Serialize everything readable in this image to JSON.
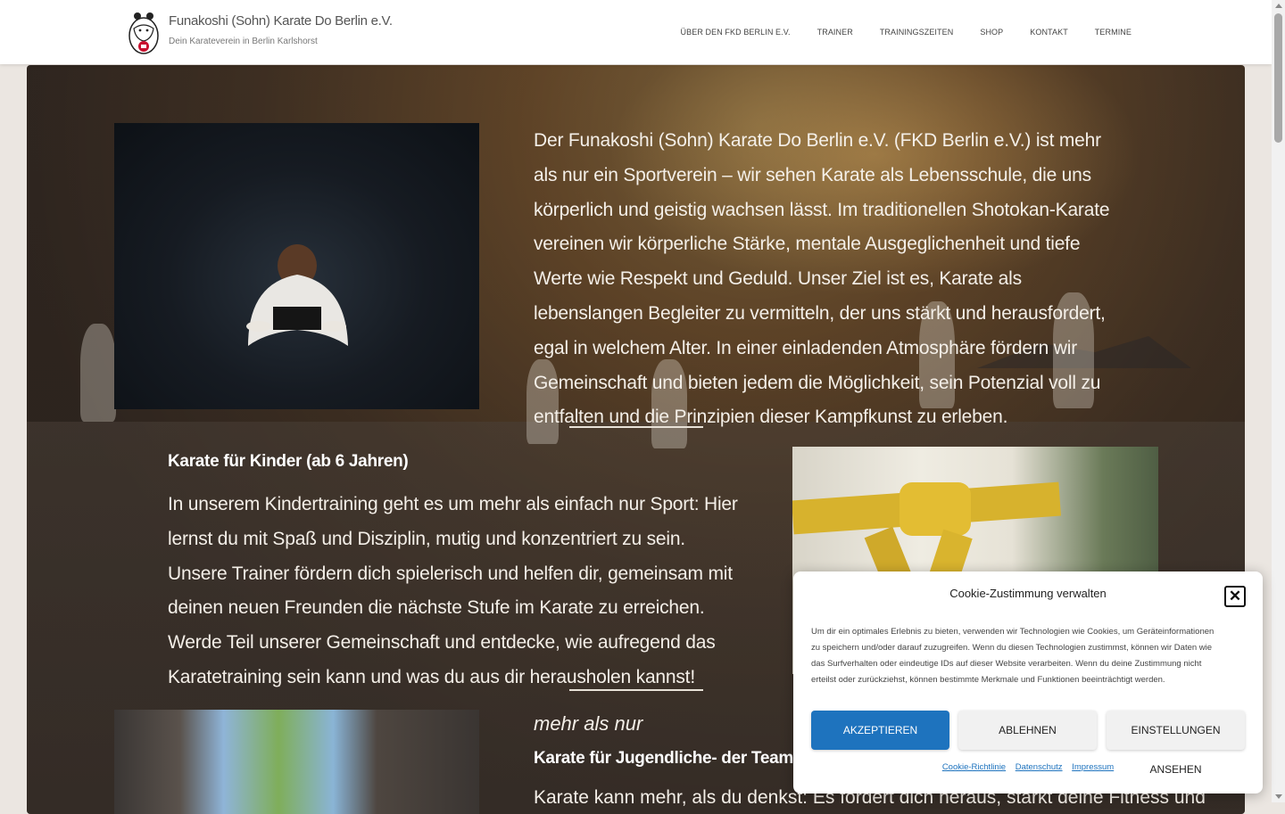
{
  "header": {
    "site_title": "Funakoshi (Sohn) Karate Do Berlin e.V.",
    "tagline": "Dein Karateverein in Berlin Karlshorst",
    "nav": [
      "Über den FKD Berlin e.V.",
      "Trainer",
      "Trainingszeiten",
      "Shop",
      "Kontakt",
      "Termine"
    ]
  },
  "intro": {
    "text": "Der Funakoshi (Sohn) Karate Do Berlin e.V. (FKD Berlin e.V.) ist mehr als nur ein Sportverein – wir sehen Karate als Lebensschule, die uns körperlich und geistig wachsen lässt. Im traditionellen Shotokan-Karate vereinen wir körperliche Stärke, mentale Ausgeglichenheit und tiefe Werte wie Respekt und Geduld. Unser Ziel ist es, Karate als lebenslangen Begleiter zu vermitteln, der uns stärkt und herausfordert, egal in welchem Alter. In einer einladenden Atmosphäre fördern wir Gemeinschaft und bieten jedem die Möglichkeit, sein Potenzial voll zu entfalten und die Prinzipien dieser Kampfkunst zu erleben."
  },
  "kids": {
    "title": "Karate für Kinder (ab 6 Jahren)",
    "text": "In unserem Kindertraining geht es um mehr als einfach nur Sport: Hier lernst du mit Spaß und Disziplin, mutig und konzentriert zu sein. Unsere Trainer fördern dich spielerisch und helfen dir, gemeinsam mit deinen neuen Freunden die nächste Stufe im Karate zu erreichen. Werde Teil unserer Gemeinschaft und entdecke, wie aufregend das Karatetraining sein kann und was du aus dir herausholen kannst!"
  },
  "youth": {
    "kicker": "mehr als nur",
    "title": "Karate für Jugendliche- der Teamgeist zählt",
    "text": "Karate kann mehr, als du denkst: Es fordert dich heraus, stärkt deine Fitness und"
  },
  "cookie": {
    "title": "Cookie-Zustimmung verwalten",
    "body": "Um dir ein optimales Erlebnis zu bieten, verwenden wir Technologien wie Cookies, um Geräteinformationen zu speichern und/oder darauf zuzugreifen. Wenn du diesen Technologien zustimmst, können wir Daten wie das Surfverhalten oder eindeutige IDs auf dieser Website verarbeiten. Wenn du deine Zustimmung nicht erteilst oder zurückziehst, können bestimmte Merkmale und Funktionen beeinträchtigt werden.",
    "accept": "Akzeptieren",
    "decline": "Ablehnen",
    "settings": "Einstellungen ansehen",
    "links": [
      "Cookie-Richtlinie",
      "Datenschutz",
      "Impressum"
    ],
    "close_icon": "close-icon",
    "accent": "#1e73be"
  }
}
